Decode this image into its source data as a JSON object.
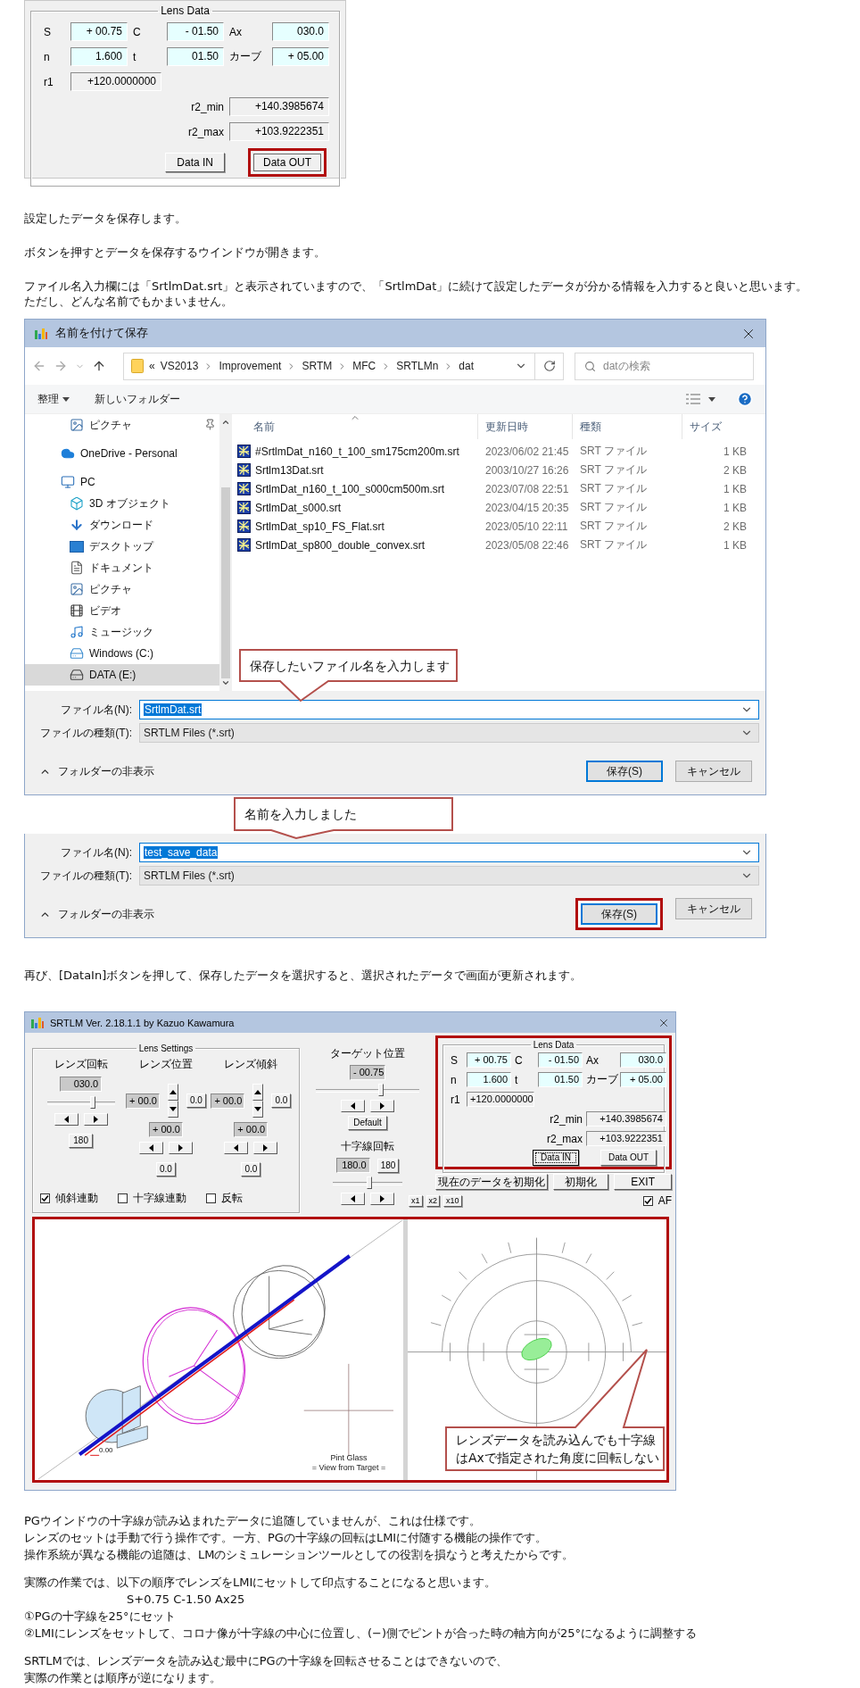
{
  "lens_data_panel": {
    "title": "Lens Data",
    "highlighted": false,
    "fields": [
      {
        "label": "S",
        "value": "+ 00.75"
      },
      {
        "label": "C",
        "value": "- 01.50"
      },
      {
        "label": "Ax",
        "value": "030.0"
      },
      {
        "label": "n",
        "value": "1.600"
      },
      {
        "label": "t",
        "value": "01.50"
      },
      {
        "label": "カーブ",
        "value": "+ 05.00"
      }
    ],
    "readouts": [
      {
        "label": "r1",
        "value": "+120.0000000"
      },
      {
        "label": "r2_min",
        "value": "+140.3985674"
      },
      {
        "label": "r2_max",
        "value": "+103.9222351"
      }
    ],
    "buttons": [
      {
        "label": "Data IN",
        "highlighted": false,
        "focused": false
      },
      {
        "label": "Data OUT",
        "highlighted": true,
        "focused": false
      }
    ]
  },
  "intro_paragraphs": [
    [
      "設定したデータを保存します。"
    ],
    [
      "ボタンを押すとデータを保存するウインドウが開きます。"
    ],
    [
      "ファイル名入力欄には「SrtlmDat.srt」と表示されていますので、「SrtlmDat」に続けて設定したデータが分かる情報を入力すると良いと思います。",
      "ただし、どんな名前でもかまいません。"
    ]
  ],
  "save_dialog": {
    "title": "名前を付けて保存",
    "path_overflow": "«",
    "path": [
      "VS2013",
      "Improvement",
      "SRTM",
      "MFC",
      "SRTLMn",
      "dat"
    ],
    "search_placeholder": "datの検索",
    "toolbar": [
      "整理",
      "新しいフォルダー"
    ],
    "nav": [
      {
        "label": "ピクチャ",
        "kind": "pictures",
        "pinned": true,
        "selected": false
      },
      {
        "label": "OneDrive - Personal",
        "kind": "cloud",
        "pinned": false,
        "selected": false
      },
      {
        "label": "PC",
        "kind": "pc",
        "pinned": false,
        "selected": false,
        "children": [
          {
            "label": "3D オブジェクト",
            "kind": "objects",
            "pinned": false,
            "selected": false
          },
          {
            "label": "ダウンロード",
            "kind": "downloads",
            "pinned": false,
            "selected": false
          },
          {
            "label": "デスクトップ",
            "kind": "desktop",
            "pinned": false,
            "selected": false
          },
          {
            "label": "ドキュメント",
            "kind": "documents",
            "pinned": false,
            "selected": false
          },
          {
            "label": "ピクチャ",
            "kind": "pictures",
            "pinned": false,
            "selected": false
          },
          {
            "label": "ビデオ",
            "kind": "videos",
            "pinned": false,
            "selected": false
          },
          {
            "label": "ミュージック",
            "kind": "music",
            "pinned": false,
            "selected": false
          },
          {
            "label": "Windows (C:)",
            "kind": "system-drive",
            "pinned": false,
            "selected": false
          },
          {
            "label": "DATA (E:)",
            "kind": "drive",
            "pinned": false,
            "selected": true
          }
        ]
      }
    ],
    "columns": [
      {
        "label": "名前",
        "sorted": true
      },
      {
        "label": "更新日時",
        "sorted": false
      },
      {
        "label": "種類",
        "sorted": false
      },
      {
        "label": "サイズ",
        "sorted": false
      }
    ],
    "files": [
      {
        "name": "#SrtlmDat_n160_t_100_sm175cm200m.srt",
        "modified": "2023/06/02 21:45",
        "type": "SRT ファイル",
        "size": "1 KB"
      },
      {
        "name": "Srtlm13Dat.srt",
        "modified": "2003/10/27 16:26",
        "type": "SRT ファイル",
        "size": "2 KB"
      },
      {
        "name": "SrtlmDat_n160_t_100_s000cm500m.srt",
        "modified": "2023/07/08 22:51",
        "type": "SRT ファイル",
        "size": "1 KB"
      },
      {
        "name": "SrtlmDat_s000.srt",
        "modified": "2023/04/15 20:35",
        "type": "SRT ファイル",
        "size": "1 KB"
      },
      {
        "name": "SrtlmDat_sp10_FS_Flat.srt",
        "modified": "2023/05/10 22:11",
        "type": "SRT ファイル",
        "size": "2 KB"
      },
      {
        "name": "SrtlmDat_sp800_double_convex.srt",
        "modified": "2023/05/08 22:46",
        "type": "SRT ファイル",
        "size": "1 KB"
      }
    ],
    "callout": "保存したいファイル名を入力します",
    "filename": {
      "label": "ファイル名(N):",
      "value": "SrtlmDat.srt",
      "text_selected": true
    },
    "filetype": {
      "label": "ファイルの種類(T):",
      "value": "SRTLM Files (*.srt)"
    },
    "hide_folders": "フォルダーの非表示",
    "buttons": [
      {
        "label": "保存(S)",
        "default": true,
        "highlighted": false
      },
      {
        "label": "キャンセル",
        "default": false,
        "highlighted": false
      }
    ]
  },
  "callout_2": "名前を入力しました",
  "save_dialog_2": {
    "filename": {
      "label": "ファイル名(N):",
      "value": "test_save_data",
      "text_selected": true
    },
    "filetype": {
      "label": "ファイルの種類(T):",
      "value": "SRTLM Files (*.srt)"
    },
    "hide_folders": "フォルダーの非表示",
    "buttons": [
      {
        "label": "保存(S)",
        "default": true,
        "highlighted": true
      },
      {
        "label": "キャンセル",
        "default": false,
        "highlighted": false
      }
    ]
  },
  "middle_paragraph": "再び、[DataIn]ボタンを押して、保存したデータを選択すると、選択されたデータで画面が更新されます。",
  "app_window": {
    "title": "SRTLM Ver. 2.18.1.1 by Kazuo Kawamura",
    "lens_settings": {
      "title": "Lens Settings",
      "rotation": {
        "label": "レンズ回転",
        "value": "030.0",
        "level": 0.68,
        "preset": "180"
      },
      "position": {
        "label": "レンズ位置",
        "value_1": "+ 00.0",
        "reset_1": "0.0",
        "value_2": "+ 00.0",
        "reset_2": "0.0"
      },
      "tilt": {
        "label": "レンズ傾斜",
        "value_1": "+ 00.0",
        "reset_1": "0.0",
        "value_2": "+ 00.0",
        "reset_2": "0.0"
      },
      "checkboxes": [
        {
          "label": "傾斜連動",
          "checked": true
        },
        {
          "label": "十字線連動",
          "checked": false
        },
        {
          "label": "反転",
          "checked": false
        }
      ]
    },
    "target": {
      "label": "ターゲット位置",
      "value": "- 00.75",
      "level": 0.63,
      "default_button": "Default"
    },
    "crosshair": {
      "label": "十字線回転",
      "value": "180.0",
      "preset": "180",
      "level": 0.52
    },
    "lens_data": {
      "title": "Lens Data",
      "highlighted": true,
      "fields": [
        {
          "label": "S",
          "value": "+ 00.75"
        },
        {
          "label": "C",
          "value": "- 01.50"
        },
        {
          "label": "Ax",
          "value": "030.0"
        },
        {
          "label": "n",
          "value": "1.600"
        },
        {
          "label": "t",
          "value": "01.50"
        },
        {
          "label": "カーブ",
          "value": "+ 05.00"
        }
      ],
      "readouts": [
        {
          "label": "r1",
          "value": "+120.0000000"
        },
        {
          "label": "r2_min",
          "value": "+140.3985674"
        },
        {
          "label": "r2_max",
          "value": "+103.9222351"
        }
      ],
      "buttons": [
        {
          "label": "Data IN",
          "highlighted": false,
          "focused": true
        },
        {
          "label": "Data OUT",
          "highlighted": false,
          "focused": false
        }
      ]
    },
    "buttons": [
      "現在のデータを初期化",
      "初期化",
      "EXIT"
    ],
    "zoom_buttons": [
      "x1",
      "x2",
      "x10"
    ],
    "af": {
      "label": "AF",
      "checked": true
    },
    "views": {
      "highlighted": true,
      "origin_label": "0.00",
      "caption": [
        "Pint Glass",
        "= View from Target ="
      ],
      "callout": [
        "レンズデータを読み込んでも十字線",
        "はAxで指定された角度に回転しない"
      ]
    }
  },
  "closing_paragraphs": [
    [
      "PGウインドウの十字線が読み込まれたデータに追随していませんが、これは仕様です。",
      "レンズのセットは手動で行う操作です。一方、PGの十字線の回転はLMIに付随する機能の操作です。",
      "操作系統が異なる機能の追随は、LMのシミュレーションツールとしての役割を損なうと考えたからです。"
    ],
    [
      "実際の作業では、以下の順序でレンズをLMIにセットして印点することになると思います。",
      "S+0.75 C-1.50 Ax25",
      "①PGの十字線を25°にセット",
      "②LMIにレンズをセットして、コロナ像が十字線の中心に位置し、(−)側でピントが合った時の軸方向が25°になるように調整する"
    ],
    [
      "SRTLMでは、レンズデータを読み込む最中にPGの十字線を回転させることはできないので、",
      "実際の作業とは順序が逆になります。"
    ]
  ]
}
